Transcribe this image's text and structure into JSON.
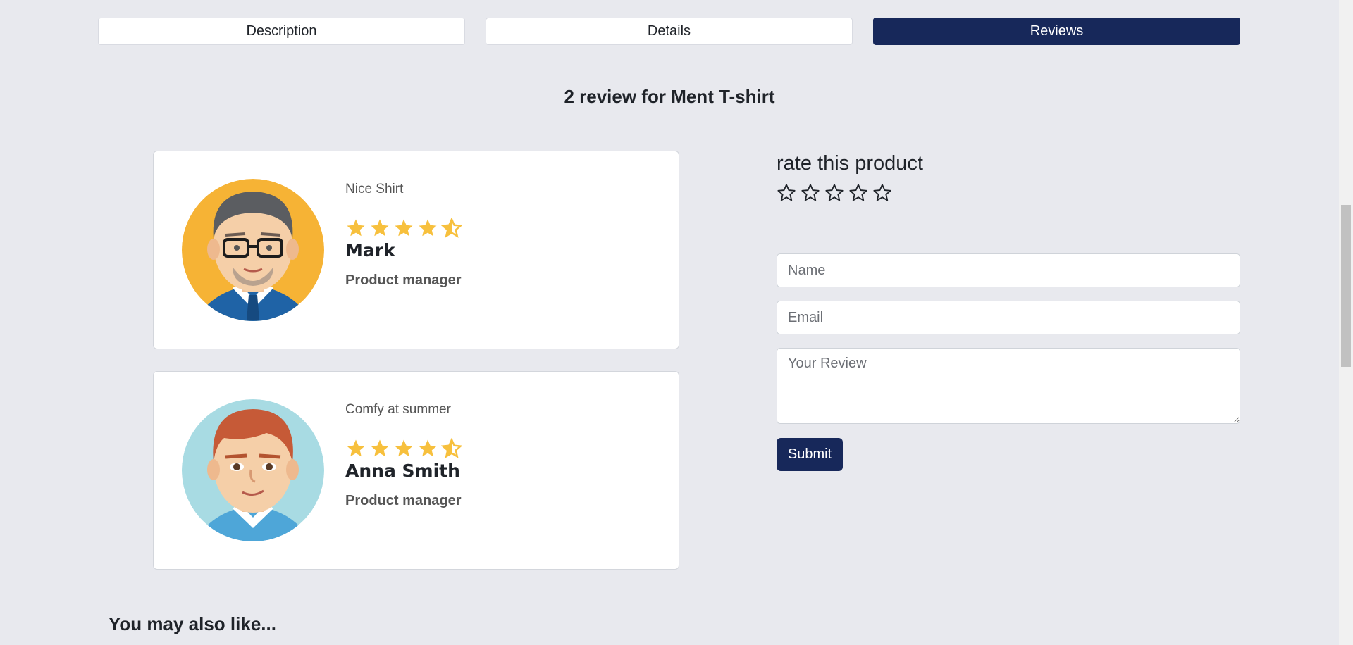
{
  "tabs": [
    {
      "label": "Description",
      "active": false
    },
    {
      "label": "Details",
      "active": false
    },
    {
      "label": "Reviews",
      "active": true
    }
  ],
  "reviews_title": "2 review for Ment T-shirt",
  "reviews": [
    {
      "headline": "Nice Shirt",
      "rating": 4.5,
      "name": "Mark",
      "role": "Product manager",
      "avatar": "man-with-glasses-avatar"
    },
    {
      "headline": "Comfy at summer",
      "rating": 4.5,
      "name": "Anna Smith",
      "role": "Product manager",
      "avatar": "young-man-avatar"
    }
  ],
  "rate_form": {
    "title": "rate this product",
    "stars": 5,
    "name_placeholder": "Name",
    "email_placeholder": "Email",
    "review_placeholder": "Your Review",
    "submit_label": "Submit"
  },
  "also_like_title": "You may also like...",
  "colors": {
    "accent": "#17285a",
    "star": "#f7c03d",
    "background": "#e8e9ee"
  }
}
